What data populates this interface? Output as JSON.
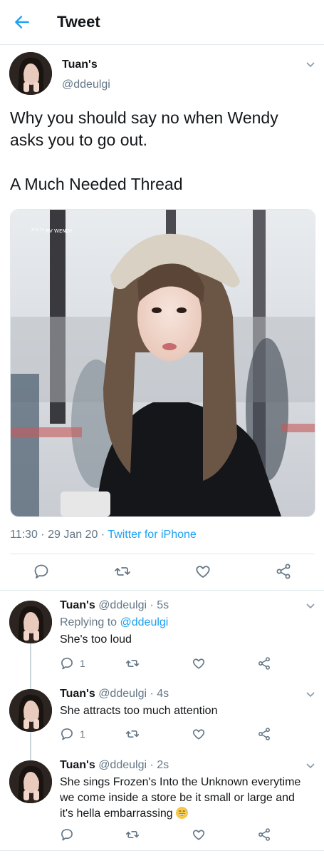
{
  "header": {
    "title": "Tweet"
  },
  "main_tweet": {
    "display_name": "Tuan's",
    "handle": "@ddeulgi",
    "text_line1": "Why you should say no when Wendy asks you to go out.",
    "text_line2": "A Much Needed Thread",
    "timestamp": "11:30 · 29 Jan 20 · ",
    "source": "Twitter for iPhone",
    "photo_watermark": "ᄌᄋᄆ  RV WENDY"
  },
  "replies": [
    {
      "display_name": "Tuan's",
      "meta": "@ddeulgi · 5s",
      "replying_prefix": "Replying to ",
      "replying_handle": "@ddeulgi",
      "text": "She's too loud",
      "reply_count": "1"
    },
    {
      "display_name": "Tuan's",
      "meta": "@ddeulgi · 4s",
      "text": "She attracts too much attention",
      "reply_count": "1"
    },
    {
      "display_name": "Tuan's",
      "meta": "@ddeulgi · 2s",
      "text": "She sings Frozen's Into the Unknown everytime we come inside a store be it small or large and it's hella embarrassing"
    }
  ],
  "icons": [
    "back-arrow-icon",
    "chevron-down-icon",
    "reply-icon",
    "retweet-icon",
    "like-icon",
    "share-icon",
    "grinning-sweat-emoji"
  ],
  "colors": {
    "accent": "#1da1f2",
    "secondary_text": "#657786",
    "divider": "#e1e8ed"
  }
}
